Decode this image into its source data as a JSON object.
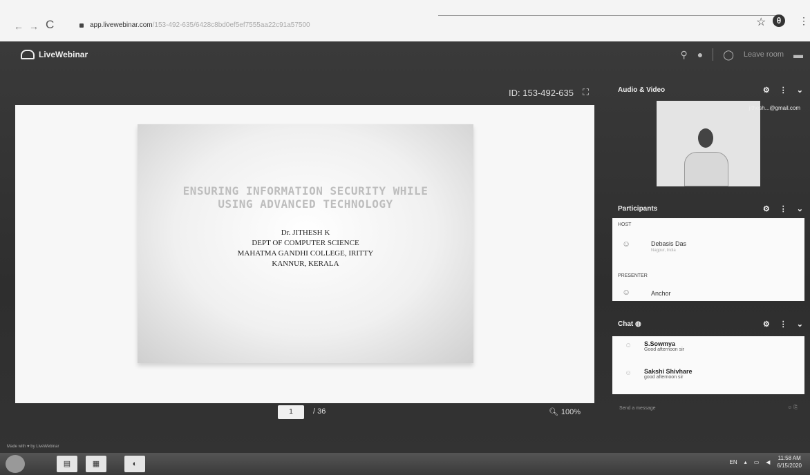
{
  "browser": {
    "url_host": "app.livewebinar.com",
    "url_path": "/153-492-635/6428c8bd0ef5ef7555aa22c91a57500",
    "nav_icons": [
      "back-icon",
      "forward-icon",
      "reload-icon"
    ],
    "star_icon": "☆",
    "account_icon": "θ",
    "menu_icon": "⋮",
    "reload_icon": "C"
  },
  "app": {
    "logo_text": "LiveWebinar",
    "leave_label": "Leave room",
    "made_with": "Made with ♥ by LiveWebinar"
  },
  "presentation": {
    "meeting_id": "ID: 153-492-635",
    "slide": {
      "title_line1": "ENSURING INFORMATION SECURITY WHILE",
      "title_line2": "USING ADVANCED TECHNOLOGY",
      "presenter": "Dr. JITHESH  K",
      "department": "DEPT OF COMPUTER SCIENCE",
      "college": "MAHATMA GANDHI COLLEGE, IRITTY",
      "location": "KANNUR, KERALA"
    },
    "current_page": "1",
    "total_pages": "/ 36",
    "zoom": "100%"
  },
  "panels": {
    "audio_video": {
      "title": "Audio & Video",
      "email": "jithesh...@gmail.com"
    },
    "participants": {
      "title": "Participants",
      "host_label": "HOST",
      "host_name": "Debasis Das",
      "host_sub": "Nagpur, India",
      "presenter_label": "PRESENTER",
      "presenter_name": "Anchor"
    },
    "chat": {
      "title": "Chat",
      "messages": [
        {
          "who": "S.Sowmya",
          "text": "Good afternoon sir"
        },
        {
          "who": "Sakshi Shivhare",
          "text": "good afternoon sir"
        }
      ],
      "send_placeholder": "Send a message"
    }
  },
  "taskbar": {
    "lang": "EN",
    "time": "11:58 AM",
    "date": "6/15/2020"
  }
}
